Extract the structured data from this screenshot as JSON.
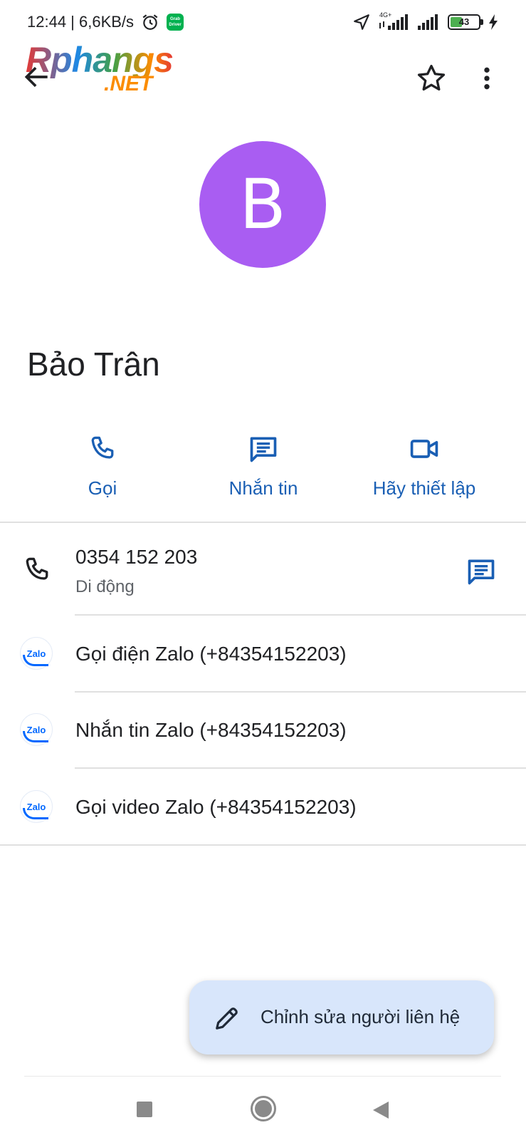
{
  "status_bar": {
    "time_speed": "12:44 | 6,6KB/s",
    "grab_badge": "Grab Driver",
    "net_type": "4G+",
    "battery_level": "43"
  },
  "app_bar": {
    "logo_main": "Rphangs",
    "logo_sub": ".NET",
    "back_icon": "arrow-back-icon",
    "star_icon": "star-outline-icon",
    "more_icon": "more-vert-icon"
  },
  "contact": {
    "avatar_letter": "B",
    "avatar_color": "#a95df2",
    "name": "Bảo Trân"
  },
  "actions": [
    {
      "label": "Gọi",
      "icon": "phone-icon"
    },
    {
      "label": "Nhắn tin",
      "icon": "message-icon"
    },
    {
      "label": "Hãy thiết lập",
      "icon": "video-icon"
    }
  ],
  "phone": {
    "number": "0354 152 203",
    "type": "Di động",
    "sms_icon": "message-icon"
  },
  "zalo_rows": [
    {
      "icon_text": "Zalo",
      "label": "Gọi điện Zalo (+84354152203)"
    },
    {
      "icon_text": "Zalo",
      "label": "Nhắn tin Zalo (+84354152203)"
    },
    {
      "icon_text": "Zalo",
      "label": "Gọi video Zalo (+84354152203)"
    }
  ],
  "fab": {
    "label": "Chỉnh sửa người liên hệ",
    "icon": "edit-pencil-icon"
  },
  "colors": {
    "accent": "#1a5fb4",
    "fab_background": "#d8e6fb",
    "zalo_blue": "#0068ff"
  }
}
